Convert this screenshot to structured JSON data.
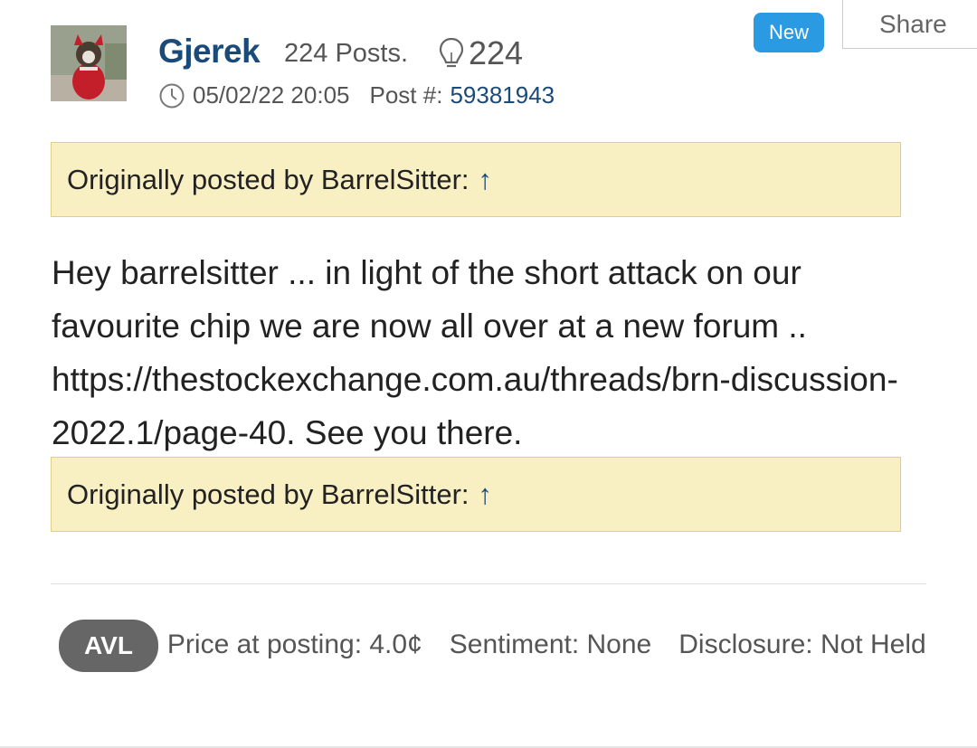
{
  "post": {
    "username": "Gjerek",
    "posts_count": "224 Posts.",
    "likes": "224",
    "timestamp": "05/02/22 20:05",
    "post_number_label": "Post #:",
    "post_number": "59381943",
    "new_badge": "New",
    "share_label": "Share",
    "quote_1": "Originally posted by BarrelSitter:",
    "quote_2": "Originally posted by BarrelSitter:",
    "quote_arrow": "↑",
    "body": "Hey barrelsitter ... in light of the short attack on our favourite chip we are now all over at a new forum .. https://thestockexchange.com.au/threads/brn-discussion-2022.1/page-40. See you there."
  },
  "footer": {
    "ticker": "AVL",
    "price": "Price at posting: 4.0¢",
    "sentiment": "Sentiment: None",
    "disclosure": "Disclosure: Not Held"
  },
  "icons": {
    "avatar": "avatar-image",
    "likes": "lightbulb-icon",
    "time": "clock-icon"
  },
  "colors": {
    "username": "#1a4a7a",
    "badge": "#2a9be3",
    "quote_bg": "#f8efc3",
    "ticker_bg": "#666666"
  }
}
